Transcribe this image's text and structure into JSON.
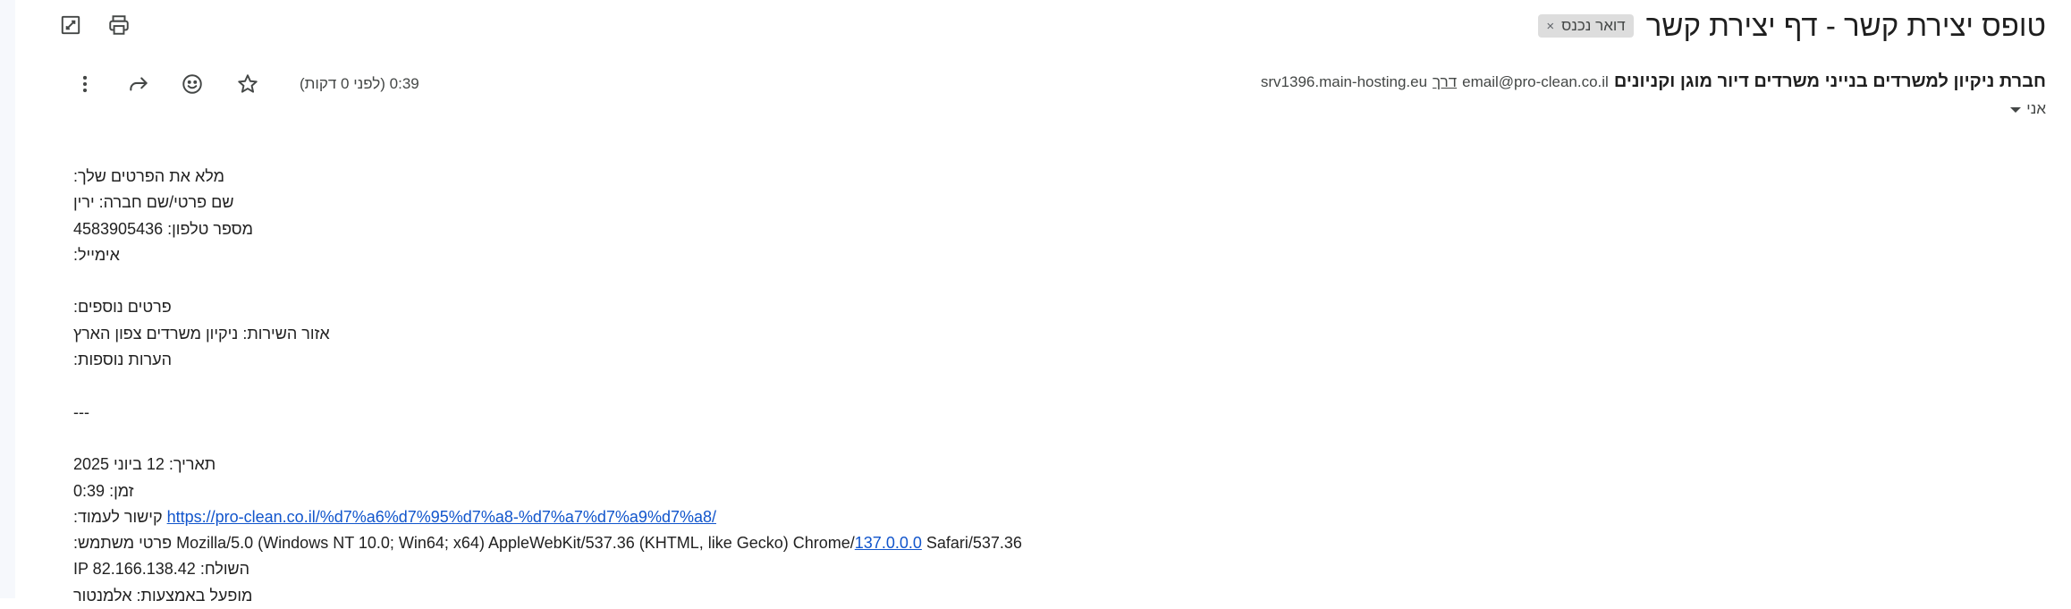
{
  "header": {
    "subject": "טופס יצירת קשר - דף יצירת קשר",
    "label_chip": "דואר נכנס",
    "label_chip_close": "×"
  },
  "sender": {
    "name": "חברת ניקיון למשרדים בנייני משרדים דיור מוגן וקניונים",
    "email": "email@pro-clean.co.il",
    "via_label": "דרך",
    "via_domain": "srv1396.main-hosting.eu"
  },
  "recipient": {
    "label": "אני"
  },
  "meta": {
    "time": "0:39 (לפני 0 דקות)"
  },
  "body": {
    "intro": "מלא את הפרטים שלך:",
    "name_label": "שם פרטי/שם חברה:",
    "name_value": "ירין",
    "phone_label": "מספר טלפון:",
    "phone_value": "4583905436",
    "email_label": "אימייל:",
    "details_title": "פרטים נוספים:",
    "area_label": "אזור השירות:",
    "area_value": "ניקיון משרדים צפון הארץ",
    "notes_label": "הערות נוספות:",
    "separator": "---",
    "date_label": "תאריך:",
    "date_value": "12 ביוני 2025",
    "time_label": "זמן:",
    "time_value": "0:39",
    "page_link_label": "קישור לעמוד:",
    "page_link_url": "https://pro-clean.co.il/%d7%a6%d7%95%d7%a8-%d7%a7%d7%a9%d7%a8/",
    "ua_label": "פרטי משתמש:",
    "ua_prefix": "Mozilla/5.0 (Windows NT 10.0; Win64; x64) AppleWebKit/537.36 (KHTML, like Gecko) Chrome/",
    "ua_link": "137.0.0.0",
    "ua_suffix": " Safari/537.36",
    "ip_label": "השולח:",
    "ip_value": "IP 82.166.138.42",
    "powered_label": "מופעל באמצעות:",
    "powered_value": "אלמנטור"
  },
  "icons": {
    "open_new_window": "open-in-new-icon",
    "print": "print-icon",
    "more": "more-vert-icon",
    "reply": "reply-icon",
    "emoji": "emoji-icon",
    "star": "star-icon"
  }
}
